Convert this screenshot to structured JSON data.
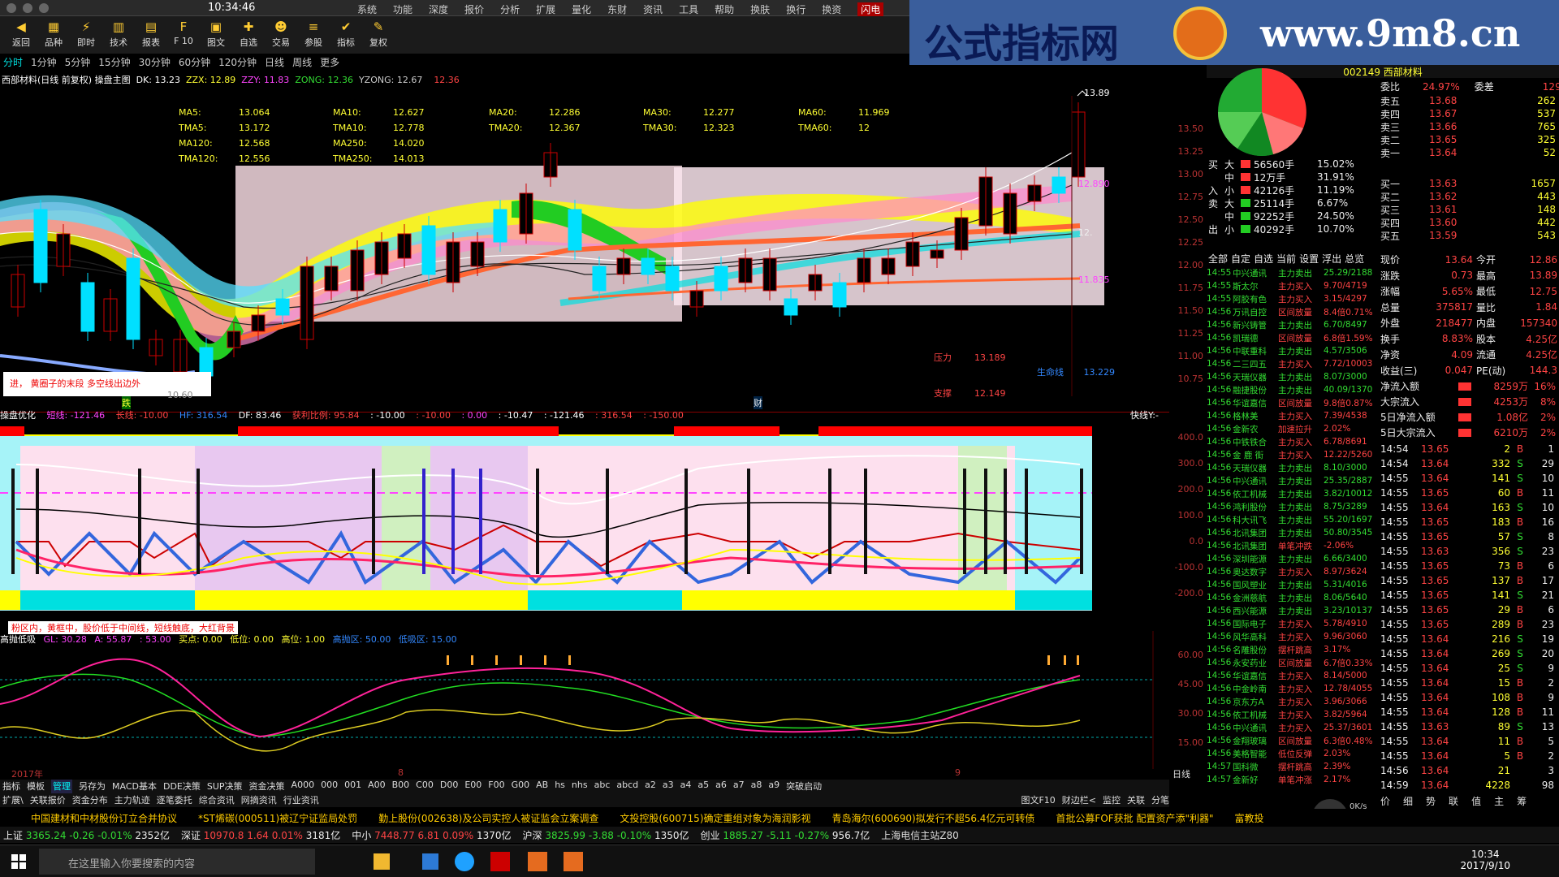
{
  "window": {
    "time": "10:34:46",
    "menus": [
      "系统",
      "功能",
      "深度",
      "报价",
      "分析",
      "扩展",
      "量化",
      "东财",
      "资讯",
      "工具",
      "帮助",
      "换肤",
      "换行",
      "换资"
    ],
    "flash_btn": "闪电"
  },
  "toolbar": [
    {
      "label": "返回",
      "icon": "arrow-left-icon",
      "glyph": "◀"
    },
    {
      "label": "品种",
      "icon": "chart-icon",
      "glyph": "▦"
    },
    {
      "label": "即时",
      "icon": "lightning-icon",
      "glyph": "⚡"
    },
    {
      "label": "技术",
      "icon": "candle-icon",
      "glyph": "▥"
    },
    {
      "label": "报表",
      "icon": "report-icon",
      "glyph": "▤"
    },
    {
      "label": "F 10",
      "icon": "f10-icon",
      "glyph": "F"
    },
    {
      "label": "图文",
      "icon": "picture-icon",
      "glyph": "▣"
    },
    {
      "label": "自选",
      "icon": "star-icon",
      "glyph": "✚"
    },
    {
      "label": "交易",
      "icon": "person-icon",
      "glyph": "☻"
    },
    {
      "label": "参股",
      "icon": "layers-icon",
      "glyph": "≡"
    },
    {
      "label": "指标",
      "icon": "check-icon",
      "glyph": "✔"
    },
    {
      "label": "复权",
      "icon": "pen-icon",
      "glyph": "✎"
    }
  ],
  "banner": {
    "left": "公式指标网",
    "right": "www.9m8.cn"
  },
  "periods": [
    "分时",
    "1分钟",
    "5分钟",
    "15分钟",
    "30分钟",
    "60分钟",
    "120分钟",
    "日线",
    "周线",
    "更多"
  ],
  "chart1": {
    "header": "西部材料(日线 前复权) 操盘主图",
    "dk": "DK: 13.23",
    "zzx": "ZZX: 12.89",
    "zzy": "ZZY: 11.83",
    "zong": "ZONG: 12.36",
    "yzong": "YZONG: 12.67",
    "last": "12.36",
    "ma": [
      [
        "MA5:",
        "13.064",
        "MA10:",
        "12.627",
        "MA20:",
        "12.286",
        "MA30:",
        "12.277",
        "MA60:",
        "11.969"
      ],
      [
        "TMA5:",
        "13.172",
        "TMA10:",
        "12.778",
        "TMA20:",
        "12.367",
        "TMA30:",
        "12.323",
        "TMA60:",
        "12"
      ],
      [
        "MA120:",
        "12.568",
        "MA250:",
        "14.020"
      ],
      [
        "TMA120:",
        "12.556",
        "TMA250:",
        "14.013"
      ]
    ],
    "hi": "13.89",
    "price_mark": "12.890",
    "mid_mark": "12.",
    "low_mark": "11.835",
    "pressure_label": "压力",
    "pressure": "13.189",
    "support_label": "支撑",
    "support": "12.149",
    "lifeline_label": "生命线",
    "lifeline": "13.229",
    "note": "进，  黄圈子的末段    多空线出边外",
    "fall_mark": "跌",
    "money_mark": "财",
    "low_price": "10.60",
    "axis": [
      "13.50",
      "13.25",
      "13.00",
      "12.75",
      "12.50",
      "12.25",
      "12.00",
      "11.75",
      "11.50",
      "11.25",
      "11.00",
      "10.75"
    ]
  },
  "chart2": {
    "title": "操盘优化",
    "items": [
      "短线: -121.46",
      "长线: -10.00",
      "HF: 316.54",
      "DF: 83.46",
      "获利比例: 95.84",
      ": -10.00",
      ": -10.00",
      ": 0.00",
      ": -10.47",
      ": -121.46",
      ": 316.54",
      ": -150.00"
    ],
    "right": "快线Y:-",
    "axis": [
      "400.0",
      "300.0",
      "200.0",
      "100.0",
      "0.0",
      "-100.0",
      "-200.0"
    ],
    "note": "粉区内，黄框中，股价低于中间线，短线触底，大红背景"
  },
  "chart3": {
    "title": "高抛低吸",
    "items": [
      "GL: 30.28",
      "A: 55.87",
      ": 53.00",
      "买点: 0.00",
      "低位: 0.00",
      "高位: 1.00",
      "高抛区: 50.00",
      "低吸区: 15.00"
    ],
    "axis": [
      "60.00",
      "45.00",
      "30.00",
      "15.00"
    ],
    "year": "2017年",
    "m8": "8",
    "m9": "9",
    "label_right": "日线"
  },
  "tabs1": [
    "指标",
    "模板",
    "管理",
    "另存为",
    "MACD基本",
    "DDE决策",
    "SUP决策",
    "资金决策",
    "A000",
    "000",
    "001",
    "A00",
    "B00",
    "C00",
    "D00",
    "E00",
    "F00",
    "G00",
    "AB",
    "hs",
    "nhs",
    "abc",
    "abcd",
    "a2",
    "a3",
    "a4",
    "a5",
    "a6",
    "a7",
    "a8",
    "a9",
    "突破启动"
  ],
  "tabs2": [
    "扩展\\",
    "关联报价",
    "资金分布",
    "主力轨迹",
    "逐笔委托",
    "综合资讯",
    "网摘资讯",
    "行业资讯"
  ],
  "tabs2_right": [
    "图文F10",
    "财边栏<",
    "监控",
    "关联",
    "分笔"
  ],
  "right_panel": {
    "header": "002149 西部材料",
    "weibi": [
      "委比",
      "24.97%",
      "委差",
      "1292"
    ],
    "sells": [
      [
        "卖五",
        "13.68",
        "262"
      ],
      [
        "卖四",
        "13.67",
        "537"
      ],
      [
        "卖三",
        "13.66",
        "765"
      ],
      [
        "卖二",
        "13.65",
        "325"
      ],
      [
        "卖一",
        "13.64",
        "52"
      ]
    ],
    "buys": [
      [
        "买一",
        "13.63",
        "1657"
      ],
      [
        "买二",
        "13.62",
        "443"
      ],
      [
        "买三",
        "13.61",
        "148"
      ],
      [
        "买四",
        "13.60",
        "442"
      ],
      [
        "买五",
        "13.59",
        "543"
      ]
    ],
    "flow": [
      [
        "大",
        "56560手",
        "15.02%"
      ],
      [
        "中",
        "12万手",
        "31.91%"
      ],
      [
        "小",
        "42126手",
        "11.19%"
      ],
      [
        "大",
        "25114手",
        "6.67%"
      ],
      [
        "中",
        "92252手",
        "24.50%"
      ],
      [
        "小",
        "40292手",
        "10.70%"
      ]
    ],
    "flow_side": [
      "买",
      "入",
      "卖",
      "出"
    ],
    "flow_tabs": [
      "全部",
      "自定",
      "自选",
      "当前",
      "设置",
      "浮出",
      "总览"
    ],
    "stats": [
      [
        "现价",
        "13.64",
        "今开",
        "12.86"
      ],
      [
        "涨跌",
        "0.73",
        "最高",
        "13.89"
      ],
      [
        "涨幅",
        "5.65%",
        "最低",
        "12.75"
      ],
      [
        "总量",
        "375817",
        "量比",
        "1.84"
      ],
      [
        "外盘",
        "218477",
        "内盘",
        "157340"
      ],
      [
        "换手",
        "8.83%",
        "股本",
        "4.25亿"
      ],
      [
        "净资",
        "4.09",
        "流通",
        "4.25亿"
      ],
      [
        "收益(三)",
        "0.047",
        "PE(动)",
        "144.3"
      ]
    ],
    "money": [
      [
        "净流入额",
        "8259万",
        "16%"
      ],
      [
        "大宗流入",
        "4253万",
        "8%"
      ],
      [
        "5日净流入额",
        "1.08亿",
        "2%"
      ],
      [
        "5日大宗流入",
        "6210万",
        "2%"
      ]
    ],
    "ticks": [
      [
        "14:54",
        "13.65",
        "2",
        "B",
        "1"
      ],
      [
        "14:54",
        "13.64",
        "332",
        "S",
        "29"
      ],
      [
        "14:55",
        "13.64",
        "141",
        "S",
        "10"
      ],
      [
        "14:55",
        "13.65",
        "60",
        "B",
        "11"
      ],
      [
        "14:55",
        "13.64",
        "163",
        "S",
        "10"
      ],
      [
        "14:55",
        "13.65",
        "183",
        "B",
        "16"
      ],
      [
        "14:55",
        "13.65",
        "57",
        "S",
        "8"
      ],
      [
        "14:55",
        "13.63",
        "356",
        "S",
        "23"
      ],
      [
        "14:55",
        "13.65",
        "73",
        "B",
        "6"
      ],
      [
        "14:55",
        "13.65",
        "137",
        "B",
        "17"
      ],
      [
        "14:55",
        "13.65",
        "141",
        "S",
        "21"
      ],
      [
        "14:55",
        "13.65",
        "29",
        "B",
        "6"
      ],
      [
        "14:55",
        "13.65",
        "289",
        "B",
        "23"
      ],
      [
        "14:55",
        "13.64",
        "216",
        "S",
        "19"
      ],
      [
        "14:55",
        "13.64",
        "269",
        "S",
        "20"
      ],
      [
        "14:55",
        "13.64",
        "25",
        "S",
        "9"
      ],
      [
        "14:55",
        "13.64",
        "15",
        "B",
        "2"
      ],
      [
        "14:55",
        "13.64",
        "108",
        "B",
        "9"
      ],
      [
        "14:55",
        "13.64",
        "128",
        "B",
        "11"
      ],
      [
        "14:55",
        "13.63",
        "89",
        "S",
        "13"
      ],
      [
        "14:55",
        "13.64",
        "11",
        "B",
        "5"
      ],
      [
        "14:55",
        "13.64",
        "5",
        "B",
        "2"
      ],
      [
        "14:56",
        "13.64",
        "21",
        "",
        "3"
      ],
      [
        "14:59",
        "13.64",
        "4228",
        "",
        "98"
      ]
    ],
    "bottom_tabs": [
      "价",
      "细",
      "势",
      "联",
      "值",
      "主",
      "筹"
    ]
  },
  "monitor": [
    [
      "14:55",
      "中兴通讯",
      "主力卖出",
      "25.29/2188"
    ],
    [
      "14:55",
      "斯太尔",
      "主力买入",
      "9.70/4719"
    ],
    [
      "14:55",
      "阿胶有色",
      "主力买入",
      "3.15/4297"
    ],
    [
      "14:56",
      "万讯自控",
      "区间放量",
      "8.4倍0.71%"
    ],
    [
      "14:56",
      "新兴铸管",
      "主力卖出",
      "6.70/8497"
    ],
    [
      "14:56",
      "凯瑞德",
      "区间放量",
      "6.8倍1.59%"
    ],
    [
      "14:56",
      "中联重科",
      "主力卖出",
      "4.57/3506"
    ],
    [
      "14:56",
      "二三四五",
      "主力买入",
      "7.72/10003"
    ],
    [
      "14:56",
      "天瑞仪器",
      "主力卖出",
      "8.07/3000"
    ],
    [
      "14:56",
      "融捷股份",
      "主力卖出",
      "40.09/1370"
    ],
    [
      "14:56",
      "华谊嘉信",
      "区间放量",
      "9.8倍0.87%"
    ],
    [
      "14:56",
      "格林美",
      "主力买入",
      "7.39/4538"
    ],
    [
      "14:56",
      "金新农",
      "加速拉升",
      "2.02%"
    ],
    [
      "14:56",
      "中铁铁合",
      "主力买入",
      "6.78/8691"
    ],
    [
      "14:56",
      "金 鹿 街",
      "主力买入",
      "12.22/5260"
    ],
    [
      "14:56",
      "天瑞仪器",
      "主力卖出",
      "8.10/3000"
    ],
    [
      "14:56",
      "中兴通讯",
      "主力卖出",
      "25.35/2887"
    ],
    [
      "14:56",
      "依工机械",
      "主力卖出",
      "3.82/10012"
    ],
    [
      "14:56",
      "鸿利股份",
      "主力卖出",
      "8.75/3289"
    ],
    [
      "14:56",
      "科大讯飞",
      "主力卖出",
      "55.20/1697"
    ],
    [
      "14:56",
      "北讯集团",
      "主力卖出",
      "50.80/3545"
    ],
    [
      "14:56",
      "北讯集团",
      "单笔冲跌",
      "-2.06%"
    ],
    [
      "14:56",
      "深圳能源",
      "主力卖出",
      "6.66/3400"
    ],
    [
      "14:56",
      "奥达数字",
      "主力买入",
      "8.97/3624"
    ],
    [
      "14:56",
      "国风塑业",
      "主力卖出",
      "5.31/4016"
    ],
    [
      "14:56",
      "金洲慈航",
      "主力卖出",
      "8.06/5640"
    ],
    [
      "14:56",
      "西兴能源",
      "主力卖出",
      "3.23/10137"
    ],
    [
      "14:56",
      "国际电子",
      "主力买入",
      "5.78/4910"
    ],
    [
      "14:56",
      "风华高科",
      "主力买入",
      "9.96/3060"
    ],
    [
      "14:56",
      "名雕股份",
      "摆杆跳高",
      "3.17%"
    ],
    [
      "14:56",
      "永安药业",
      "区间放量",
      "6.7倍0.33%"
    ],
    [
      "14:56",
      "华谊嘉信",
      "主力买入",
      "8.14/5000"
    ],
    [
      "14:56",
      "中金岭南",
      "主力买入",
      "12.78/4055"
    ],
    [
      "14:56",
      "京东方A",
      "主力买入",
      "3.96/3066"
    ],
    [
      "14:56",
      "依工机械",
      "主力买入",
      "3.82/5964"
    ],
    [
      "14:56",
      "中兴通讯",
      "主力买入",
      "25.37/3601"
    ],
    [
      "14:56",
      "金翔玻璃",
      "区间放量",
      "6.3倍0.48%"
    ],
    [
      "14:56",
      "美格智能",
      "低位反弹",
      "2.03%"
    ],
    [
      "14:57",
      "国科微",
      "摆杆跳高",
      "2.39%"
    ],
    [
      "14:57",
      "金新好",
      "单笔冲涨",
      "2.17%"
    ]
  ],
  "ticker": [
    "中国建材和中材股份订立合并协议",
    "*ST烯碳(000511)被辽宁证监局处罚",
    "勤上股份(002638)及公司实控人被证监会立案调查",
    "文投控股(600715)确定重组对象为海润影视",
    "青岛海尔(600690)拟发行不超56.4亿元可转债",
    "首批公募FOF获批 配置资产添\"利器\"",
    "富教投"
  ],
  "indices": [
    {
      "name": "上证",
      "v": "3365.24",
      "c": "-0.26",
      "p": "-0.01%",
      "a": "2352亿"
    },
    {
      "name": "深证",
      "v": "10970.8",
      "c": "1.64",
      "p": "0.01%",
      "a": "3181亿"
    },
    {
      "name": "中小",
      "v": "7448.77",
      "c": "6.81",
      "p": "0.09%",
      "a": "1370亿"
    },
    {
      "name": "沪深",
      "v": "3825.99",
      "c": "-3.88",
      "p": "-0.10%",
      "a": "1350亿"
    },
    {
      "name": "创业",
      "v": "1885.27",
      "c": "-5.11",
      "p": "-0.27%",
      "a": "956.7亿"
    }
  ],
  "idx_right": "上海电信主站Z80",
  "speed": "46%",
  "speed_unit": "0K/s",
  "taskbar": {
    "search": "在这里输入你要搜索的内容",
    "time": "10:34",
    "date": "2017/9/10"
  },
  "colors": {
    "up": "#ff4444",
    "down": "#33dd33",
    "accent": "#00e0e0"
  }
}
